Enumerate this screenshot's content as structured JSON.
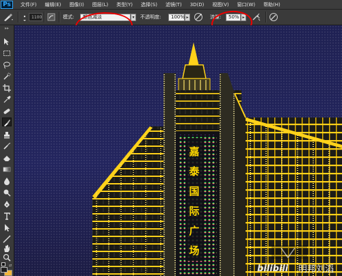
{
  "app": {
    "logo": "Ps"
  },
  "menu": [
    "文件(F)",
    "编辑(E)",
    "图像(I)",
    "图层(L)",
    "类型(Y)",
    "选择(S)",
    "滤镜(T)",
    "3D(D)",
    "视图(V)",
    "窗口(W)",
    "帮助(H)"
  ],
  "options": {
    "brush_size": "1100",
    "mode_label": "模式:",
    "mode_value": "颜色减淡",
    "opacity_label": "不透明度:",
    "opacity_value": "100%",
    "flow_label": "流量:",
    "flow_value": "50%"
  },
  "tools": [
    "move-icon",
    "marquee-icon",
    "lasso-icon",
    "quick-select-icon",
    "crop-icon",
    "eyedropper-icon",
    "healing-icon",
    "brush-icon",
    "clone-stamp-icon",
    "history-brush-icon",
    "eraser-icon",
    "gradient-icon",
    "blur-icon",
    "dodge-icon",
    "pen-icon",
    "type-icon",
    "path-select-icon",
    "shape-icon",
    "hand-icon",
    "zoom-icon"
  ],
  "colors": {
    "foreground": "#1e1e1e",
    "background": "#f2b63a",
    "annotation": "#ee0000",
    "lights": "#ffd800"
  },
  "canvas": {
    "sign": [
      "嘉",
      "泰",
      "国",
      "际",
      "广",
      "场"
    ],
    "watermark_left": "bilibili",
    "watermark_right": "明邦刘滔"
  }
}
